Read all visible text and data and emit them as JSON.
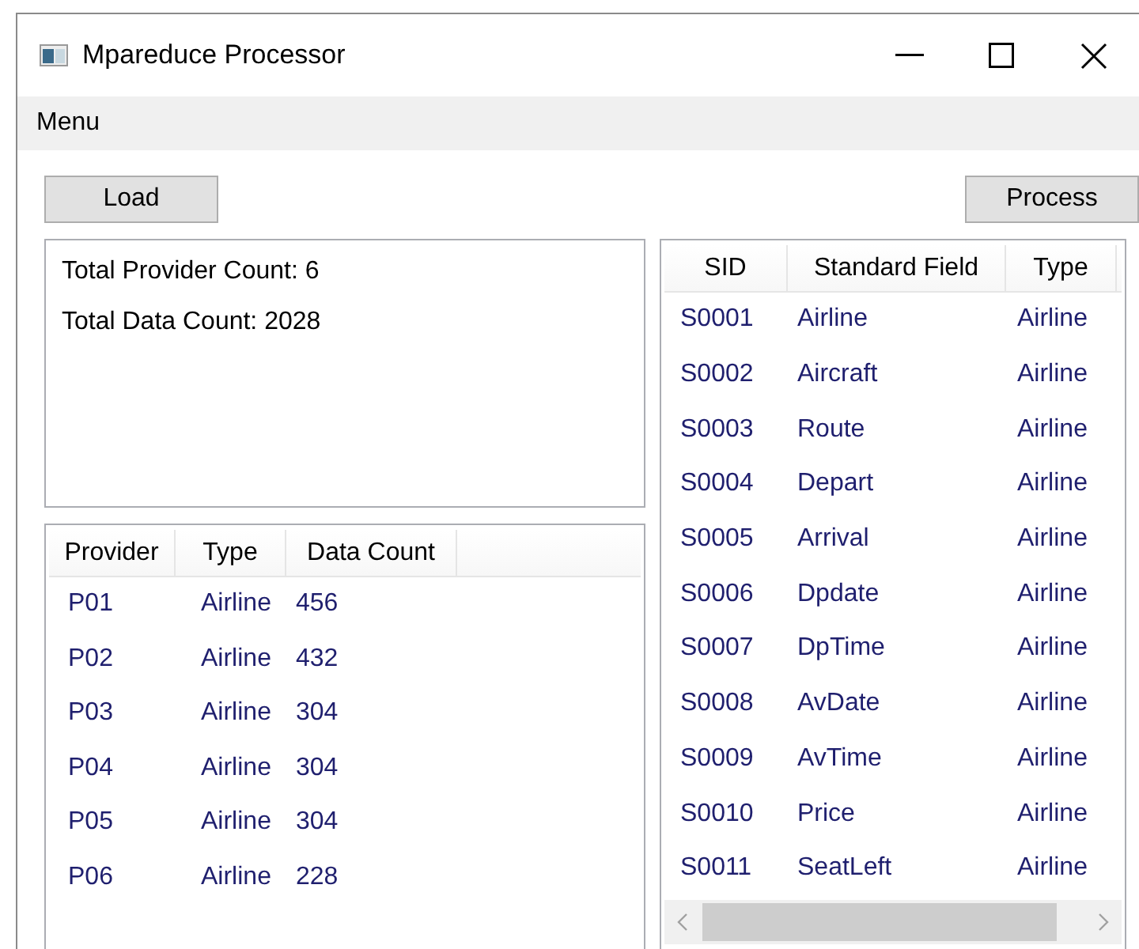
{
  "window": {
    "title": "Mpareduce Processor"
  },
  "menu": [
    "Menu"
  ],
  "buttons": {
    "load": "Load",
    "process": "Process"
  },
  "summary": [
    "Total Provider Count: 6",
    "Total Data Count: 2028"
  ],
  "providers": {
    "columns": [
      "Provider",
      "Type",
      "Data Count"
    ],
    "rows": [
      [
        "P01",
        "Airline",
        "456"
      ],
      [
        "P02",
        "Airline",
        "432"
      ],
      [
        "P03",
        "Airline",
        "304"
      ],
      [
        "P04",
        "Airline",
        "304"
      ],
      [
        "P05",
        "Airline",
        "304"
      ],
      [
        "P06",
        "Airline",
        "228"
      ]
    ]
  },
  "fields": {
    "columns": [
      "SID",
      "Standard Field",
      "Type"
    ],
    "rows": [
      [
        "S0001",
        "Airline",
        "Airline"
      ],
      [
        "S0002",
        "Aircraft",
        "Airline"
      ],
      [
        "S0003",
        "Route",
        "Airline"
      ],
      [
        "S0004",
        "Depart",
        "Airline"
      ],
      [
        "S0005",
        "Arrival",
        "Airline"
      ],
      [
        "S0006",
        "Dpdate",
        "Airline"
      ],
      [
        "S0007",
        "DpTime",
        "Airline"
      ],
      [
        "S0008",
        "AvDate",
        "Airline"
      ],
      [
        "S0009",
        "AvTime",
        "Airline"
      ],
      [
        "S0010",
        "Price",
        "Airline"
      ],
      [
        "S0011",
        "SeatLeft",
        "Airline"
      ]
    ]
  }
}
